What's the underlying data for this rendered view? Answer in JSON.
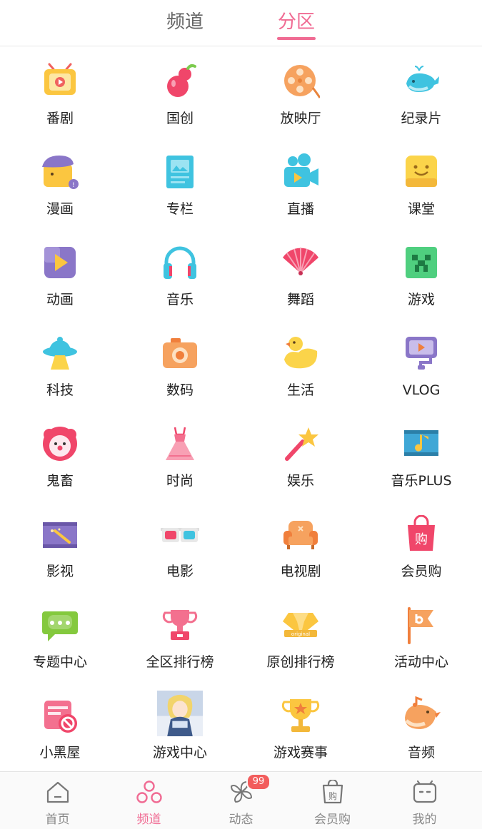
{
  "tabs": {
    "channel": "频道",
    "zone": "分区"
  },
  "zones": [
    {
      "label": "番剧",
      "icon": "tv-icon"
    },
    {
      "label": "国创",
      "icon": "gourd-icon"
    },
    {
      "label": "放映厅",
      "icon": "film-reel-icon"
    },
    {
      "label": "纪录片",
      "icon": "whale-icon"
    },
    {
      "label": "漫画",
      "icon": "comic-character-icon"
    },
    {
      "label": "专栏",
      "icon": "article-icon"
    },
    {
      "label": "直播",
      "icon": "video-camera-icon"
    },
    {
      "label": "课堂",
      "icon": "smile-block-icon"
    },
    {
      "label": "动画",
      "icon": "animation-play-icon"
    },
    {
      "label": "音乐",
      "icon": "headphones-icon"
    },
    {
      "label": "舞蹈",
      "icon": "fan-icon"
    },
    {
      "label": "游戏",
      "icon": "creeper-icon"
    },
    {
      "label": "科技",
      "icon": "ufo-icon"
    },
    {
      "label": "数码",
      "icon": "camera-icon"
    },
    {
      "label": "生活",
      "icon": "duck-icon"
    },
    {
      "label": "VLOG",
      "icon": "vlog-camera-icon"
    },
    {
      "label": "鬼畜",
      "icon": "clown-icon"
    },
    {
      "label": "时尚",
      "icon": "dress-icon"
    },
    {
      "label": "娱乐",
      "icon": "magic-wand-icon"
    },
    {
      "label": "音乐PLUS",
      "icon": "music-film-icon"
    },
    {
      "label": "影视",
      "icon": "clapper-icon"
    },
    {
      "label": "电影",
      "icon": "3d-glasses-icon"
    },
    {
      "label": "电视剧",
      "icon": "sofa-icon"
    },
    {
      "label": "会员购",
      "icon": "shopping-bag-icon"
    },
    {
      "label": "专题中心",
      "icon": "chat-bubble-icon"
    },
    {
      "label": "全区排行榜",
      "icon": "trophy-cup-icon"
    },
    {
      "label": "原创排行榜",
      "icon": "diamond-crown-icon"
    },
    {
      "label": "活动中心",
      "icon": "flag-icon"
    },
    {
      "label": "小黑屋",
      "icon": "ban-calendar-icon"
    },
    {
      "label": "游戏中心",
      "icon": "game-thumbnail-icon"
    },
    {
      "label": "游戏赛事",
      "icon": "star-trophy-icon"
    },
    {
      "label": "音频",
      "icon": "bird-icon"
    }
  ],
  "bottom_nav": [
    {
      "label": "首页",
      "icon": "home-icon"
    },
    {
      "label": "频道",
      "icon": "channel-circles-icon"
    },
    {
      "label": "动态",
      "icon": "pinwheel-icon"
    },
    {
      "label": "会员购",
      "icon": "bag-icon"
    },
    {
      "label": "我的",
      "icon": "tv-face-icon"
    }
  ],
  "badge": "99",
  "colors": {
    "accent": "#f06b93",
    "badge": "#f25d5d",
    "text": "#222222",
    "muted": "#888888"
  }
}
